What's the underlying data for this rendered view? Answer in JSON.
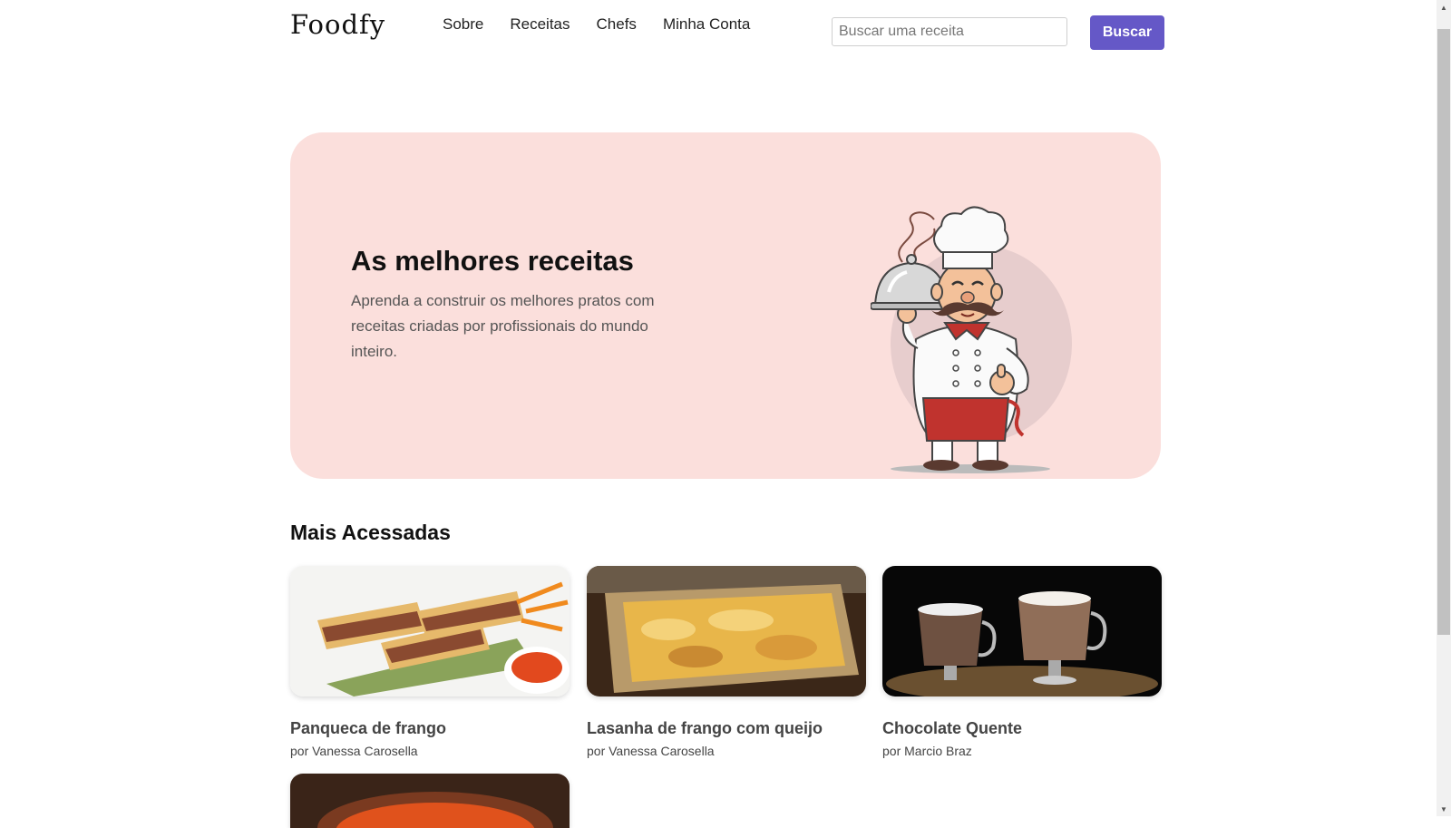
{
  "header": {
    "logo": "Foodfy",
    "nav": [
      "Sobre",
      "Receitas",
      "Chefs",
      "Minha Conta"
    ],
    "search_placeholder": "Buscar uma receita",
    "search_button": "Buscar"
  },
  "hero": {
    "title": "As melhores receitas",
    "description": "Aprenda a construir os melhores pratos com receitas criadas por profissionais do mundo inteiro."
  },
  "section": {
    "title": "Mais Acessadas",
    "recipes": [
      {
        "title": "Panqueca de frango",
        "author": "por Vanessa Carosella"
      },
      {
        "title": "Lasanha de frango com queijo",
        "author": "por Vanessa Carosella"
      },
      {
        "title": "Chocolate Quente",
        "author": "por Marcio Braz"
      }
    ]
  },
  "colors": {
    "accent": "#6558c7",
    "hero_bg": "#fbdfdc"
  }
}
